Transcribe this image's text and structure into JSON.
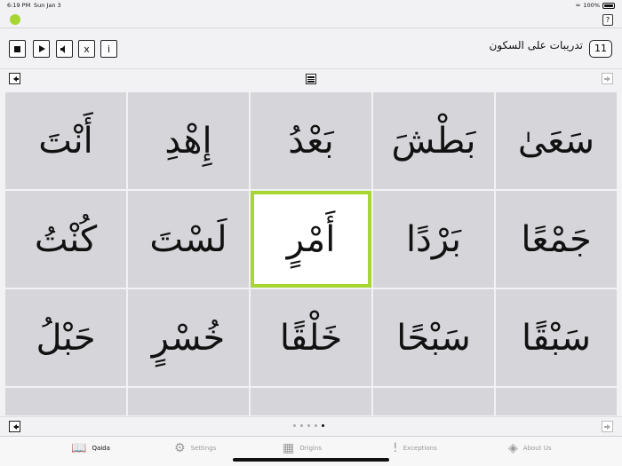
{
  "status": {
    "time": "6:19 PM",
    "date": "Sun Jan 3",
    "battery": "100%"
  },
  "help_label": "?",
  "controls": {
    "stop": "stop",
    "play": "play",
    "speaker": "speaker",
    "close_label": "x",
    "info_label": "i"
  },
  "lesson": {
    "title": "تدريبات على السكون",
    "number": "11"
  },
  "grid": {
    "cells": [
      "أَنْتَ",
      "إِهْدِ",
      "بَعْدُ",
      "بَطْشَ",
      "سَعَىٰ",
      "كُنْتُ",
      "لَسْتَ",
      "أَمْرٍ",
      "بَرْدًا",
      "جَمْعًا",
      "حَبْلُ",
      "خُسْرٍ",
      "خَلْقًا",
      "سَبْحًا",
      "سَبْقًا",
      "",
      "",
      "",
      "",
      ""
    ],
    "selected_index": 7
  },
  "pager": {
    "count": 5,
    "active": 4
  },
  "tabs": [
    {
      "label": "Qaida",
      "icon": "book-icon",
      "active": true
    },
    {
      "label": "Settings",
      "icon": "gear-icon",
      "active": false
    },
    {
      "label": "Origins",
      "icon": "puzzle-icon",
      "active": false
    },
    {
      "label": "Exceptions",
      "icon": "exclamation-icon",
      "active": false
    },
    {
      "label": "About Us",
      "icon": "diamond-icon",
      "active": false
    }
  ],
  "colors": {
    "accent": "#a8d631",
    "cell": "#d5d5da"
  }
}
